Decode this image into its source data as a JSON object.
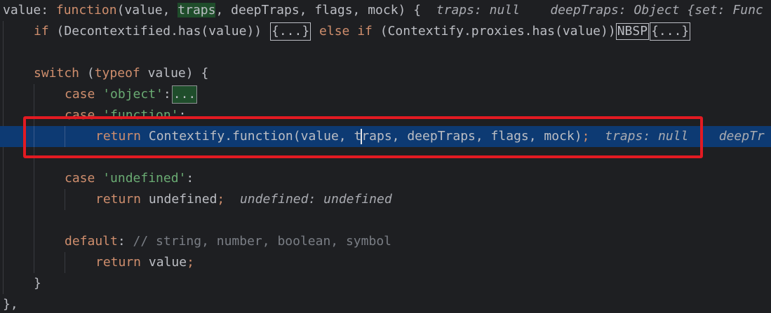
{
  "lines": {
    "l1": {
      "name": "value",
      "colon": ":",
      "fn_kw": "function",
      "open": "(value, ",
      "highlighted_param": "traps",
      "rest": ", deepTraps, flags, mock) {",
      "hint1": "traps: null",
      "hint2": "deepTraps: Object {set: Func"
    },
    "l2": {
      "if_kw": "if",
      "cond1": "(Decontextified.has(value))",
      "fold1": "{...}",
      "else_kw": "else",
      "if_kw2": "if",
      "cond2": "(Contextify.proxies.has(value))",
      "nbsp": "NBSP",
      "fold2": "{...}"
    },
    "l4": {
      "switch_kw": "switch",
      "open": " (",
      "typeof_kw": "typeof",
      "rest": " value) {"
    },
    "l5": {
      "case_kw": "case",
      "str": "'object'",
      "colon": ":",
      "fold": "..."
    },
    "l6": {
      "case_kw": "case",
      "str": "'function'",
      "colon": ":"
    },
    "l7": {
      "return_kw": "return",
      "call_before_caret": " Contextify.function(value, t",
      "call_after_caret": "raps",
      "call_rest": ", deepTraps, flags, mock)",
      "semi": ";",
      "hint1": "traps: null",
      "hint2": "deepTr"
    },
    "l9": {
      "case_kw": "case",
      "str": "'undefined'",
      "colon": ":"
    },
    "l10": {
      "return_kw": "return",
      "val": " undefined",
      "semi": ";",
      "hint": "undefined: undefined"
    },
    "l12": {
      "default_kw": "default",
      "colon": ":",
      "comment": " // string, number, boolean, symbol"
    },
    "l13": {
      "return_kw": "return",
      "val": " value",
      "semi": ";"
    },
    "l14": {
      "brace": "}"
    },
    "l15": {
      "brace": "},"
    }
  }
}
